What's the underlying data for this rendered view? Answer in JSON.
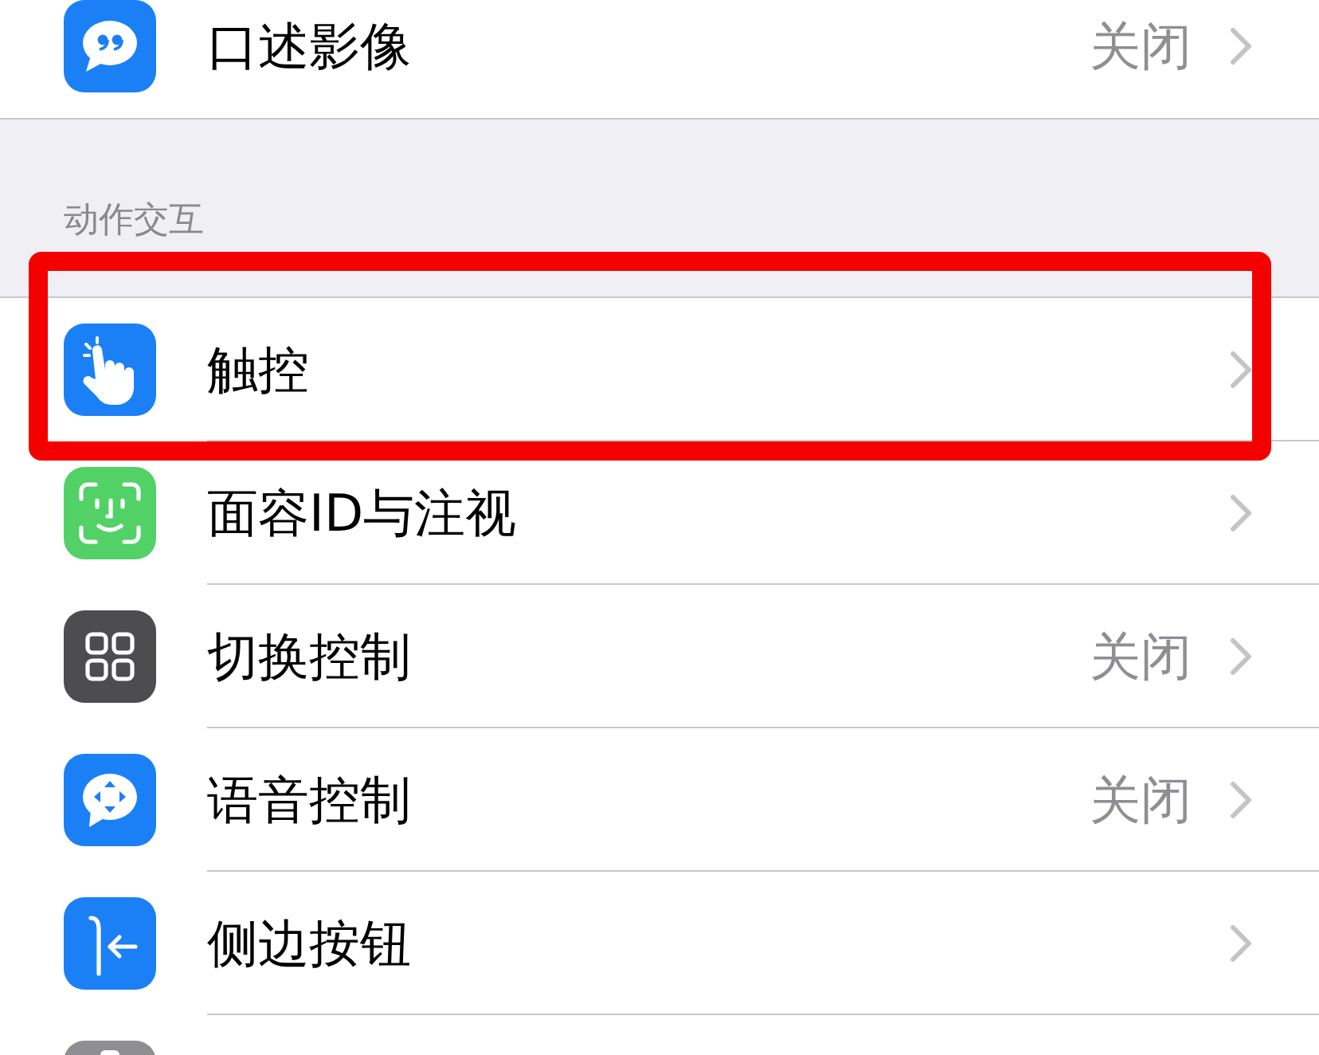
{
  "groups": [
    {
      "rows": [
        {
          "kind": "quote",
          "label": "口述影像",
          "value": "关闭",
          "highlighted": false
        }
      ]
    },
    {
      "header": "动作交互",
      "rows": [
        {
          "kind": "touch",
          "label": "触控",
          "highlighted": true
        },
        {
          "kind": "face",
          "label": "面容ID与注视",
          "highlighted": false
        },
        {
          "kind": "switch",
          "label": "切换控制",
          "value": "关闭",
          "highlighted": false
        },
        {
          "kind": "voice",
          "label": "语音控制",
          "value": "关闭",
          "highlighted": false
        },
        {
          "kind": "side",
          "label": "侧边按钮",
          "highlighted": false
        },
        {
          "kind": "partial",
          "highlighted": false
        }
      ]
    }
  ]
}
